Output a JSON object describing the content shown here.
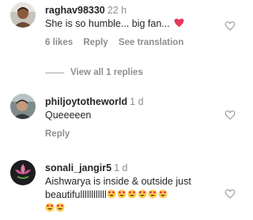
{
  "comments": [
    {
      "username": "raghav98330",
      "time": "22 h",
      "text": "She is so humble... big fan...",
      "likes": "6 likes",
      "reply": "Reply",
      "see_translation": "See translation",
      "emoji": "pink-heart"
    },
    {
      "username": "philjoytotheworld",
      "time": "1 d",
      "text": "Queeeeen",
      "reply": "Reply"
    },
    {
      "username": "sonali_jangir5",
      "time": "1 d",
      "text_line1": "Aishwarya is inside & outside just",
      "text_line2": "beautifullllllllllll",
      "emoji": "smiling-face-with-heart-eyes",
      "emoji_count_line2": 6,
      "emoji_count_line3": 2
    }
  ],
  "view_replies": "View all 1 replies",
  "colors": {
    "muted": "#8e8e8e",
    "text": "#262626",
    "heart_emoji": "#e8375a"
  }
}
